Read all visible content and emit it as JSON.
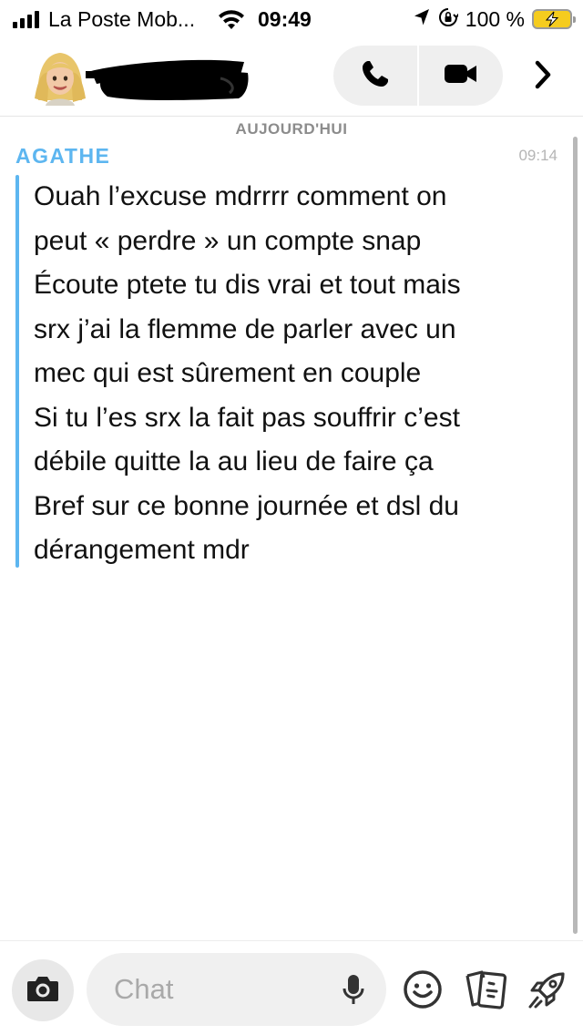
{
  "status_bar": {
    "carrier": "La Poste Mob...",
    "time": "09:49",
    "battery_percent": "100 %",
    "battery_color": "#f5cc1e"
  },
  "header": {
    "contact_name": "(redacted)",
    "icons": [
      "avatar",
      "phone-icon",
      "video-camera-icon",
      "chevron-right-icon"
    ]
  },
  "conversation": {
    "date_separator": "AUJOURD'HUI",
    "messages": [
      {
        "sender": "AGATHE",
        "time": "09:14",
        "sender_color": "#5db6f0",
        "lines": [
          "Ouah l’excuse mdrrrr comment on",
          "peut « perdre » un compte snap",
          "Écoute ptete tu dis vrai et tout mais",
          "srx j’ai la flemme de parler avec un",
          "mec qui est sûrement en couple",
          "Si tu l’es srx la fait pas souffrir c’est",
          "débile quitte la au lieu de faire ça",
          "Bref sur ce bonne journée et dsl du",
          "dérangement mdr"
        ]
      }
    ]
  },
  "composer": {
    "placeholder": "Chat",
    "icons": [
      "camera-icon",
      "microphone-icon",
      "emoji-icon",
      "sticker-icon",
      "rocket-icon"
    ]
  }
}
